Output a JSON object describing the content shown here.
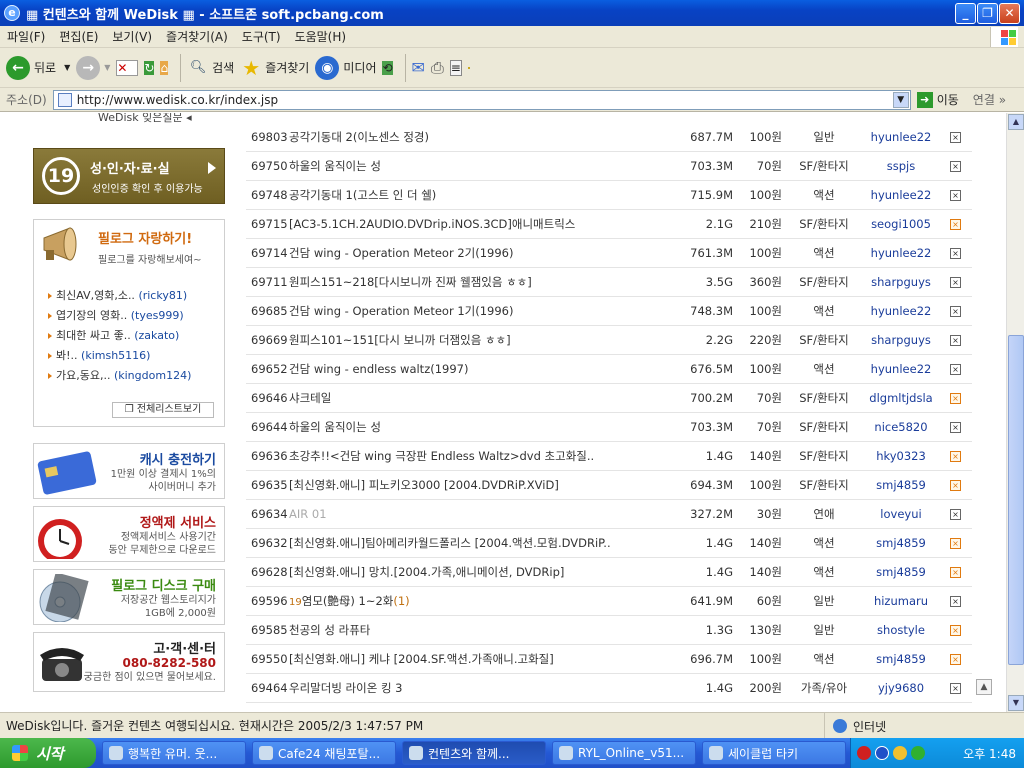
{
  "window": {
    "title": "▦ 컨텐츠와 함께 WeDisk ▦ - 소프트존 soft.pcbang.com",
    "min_label": "_",
    "max_label": "❐",
    "close_label": "✕"
  },
  "menu": [
    "파일(F)",
    "편집(E)",
    "보기(V)",
    "즐겨찾기(A)",
    "도구(T)",
    "도움말(H)"
  ],
  "toolbar": {
    "back": "뒤로",
    "search": "검색",
    "favorites": "즐겨찾기",
    "media": "미디어"
  },
  "address": {
    "label": "주소(D)",
    "url": "http://www.wedisk.co.kr/index.jsp",
    "go": "이동",
    "links": "연결"
  },
  "sidebar": {
    "top_note": "WeDisk 잊은질문",
    "adult": {
      "badge": "19",
      "title": "성·인·자·료·실",
      "subtitle": "성인인증 확인 후 이용가능"
    },
    "brag": {
      "title": "필로그 자랑하기!",
      "subtitle": "필로그를 자랑해보세여~",
      "items": [
        {
          "title": "최신AV,영화,소..",
          "user": "(ricky81)"
        },
        {
          "title": "엽기장의 영화..",
          "user": "(tyes999)"
        },
        {
          "title": "최대한 싸고 좋..",
          "user": "(zakato)"
        },
        {
          "title": "봐!..",
          "user": "(kimsh5116)"
        },
        {
          "title": "가요,동요,..",
          "user": "(kingdom124)"
        }
      ],
      "more": "전체리스트보기"
    },
    "promos": [
      {
        "title": "캐시 충전하기",
        "sub1": "1만원 이상 결제시 1%의",
        "sub2": "사이버머니 추가",
        "color": "#1a4aa0"
      },
      {
        "title": "정액제 서비스",
        "sub1": "정액제서비스 사용기간",
        "sub2": "동안 무제한으로 다운로드",
        "color": "#b01818"
      },
      {
        "title": "필로그 디스크 구매",
        "sub1": "저장공간 웹스토리지가",
        "sub2": "1GB에 2,000원",
        "color": "#3a8a10"
      },
      {
        "title": "고·객·센·터",
        "sub1": "080-8282-580",
        "sub2": "궁금한 점이 있으면 물어보세요.",
        "color": "#222"
      }
    ]
  },
  "list": [
    {
      "num": "69803",
      "title": "공각기동대 2(이노센스 정경)",
      "size": "687.7M",
      "price": "100원",
      "genre": "일반",
      "user": "hyunlee22",
      "box": "gray"
    },
    {
      "num": "69750",
      "title": "하울의 움직이는 성",
      "size": "703.3M",
      "price": "70원",
      "genre": "SF/환타지",
      "user": "sspjs",
      "box": "gray"
    },
    {
      "num": "69748",
      "title": "공각기동대 1(고스트 인 더 쉘)",
      "size": "715.9M",
      "price": "100원",
      "genre": "액션",
      "user": "hyunlee22",
      "box": "gray"
    },
    {
      "num": "69715",
      "title": "[AC3-5.1CH.2AUDIO.DVDrip.iNOS.3CD]애니매트릭스",
      "size": "2.1G",
      "price": "210원",
      "genre": "SF/환타지",
      "user": "seogi1005",
      "box": "orange"
    },
    {
      "num": "69714",
      "title": "건담 wing - Operation Meteor 2기(1996)",
      "size": "761.3M",
      "price": "100원",
      "genre": "액션",
      "user": "hyunlee22",
      "box": "gray"
    },
    {
      "num": "69711",
      "title": "원피스151~218[다시보니까 진짜 웰잼있음 ㅎㅎ]",
      "size": "3.5G",
      "price": "360원",
      "genre": "SF/환타지",
      "user": "sharpguys",
      "box": "gray"
    },
    {
      "num": "69685",
      "title": "건담 wing - Operation Meteor 1기(1996)",
      "size": "748.3M",
      "price": "100원",
      "genre": "액션",
      "user": "hyunlee22",
      "box": "gray"
    },
    {
      "num": "69669",
      "title": "원피스101~151[다시 보니까 더잼있음 ㅎㅎ]",
      "size": "2.2G",
      "price": "220원",
      "genre": "SF/환타지",
      "user": "sharpguys",
      "box": "gray"
    },
    {
      "num": "69652",
      "title": "건담 wing - endless waltz(1997)",
      "size": "676.5M",
      "price": "100원",
      "genre": "액션",
      "user": "hyunlee22",
      "box": "gray"
    },
    {
      "num": "69646",
      "title": "샤크테일",
      "size": "700.2M",
      "price": "70원",
      "genre": "SF/환타지",
      "user": "dlgmltjdsla",
      "box": "orange"
    },
    {
      "num": "69644",
      "title": "하울의 움직이는 성",
      "size": "703.3M",
      "price": "70원",
      "genre": "SF/환타지",
      "user": "nice5820",
      "box": "gray"
    },
    {
      "num": "69636",
      "title": "초강추!!<건담 wing 극장판 Endless Waltz>dvd 초고화질..",
      "size": "1.4G",
      "price": "140원",
      "genre": "SF/환타지",
      "user": "hky0323",
      "box": "orange"
    },
    {
      "num": "69635",
      "title": "[최신영화.애니] 피노키오3000 [2004.DVDRiP.XViD]",
      "size": "694.3M",
      "price": "100원",
      "genre": "SF/환타지",
      "user": "smj4859",
      "box": "orange"
    },
    {
      "num": "69634",
      "title": "AIR 01",
      "size": "327.2M",
      "price": "30원",
      "genre": "연애",
      "user": "loveyui",
      "box": "gray",
      "gray": true
    },
    {
      "num": "69632",
      "title": "[최신영화.애니]팀아메리카월드폴리스 [2004.액션.모험.DVDRiP..",
      "size": "1.4G",
      "price": "140원",
      "genre": "액션",
      "user": "smj4859",
      "box": "orange"
    },
    {
      "num": "69628",
      "title": "[최신영화.애니] 망치.[2004.가족,애니메이션, DVDRip]",
      "size": "1.4G",
      "price": "140원",
      "genre": "액션",
      "user": "smj4859",
      "box": "orange"
    },
    {
      "num": "69596",
      "title_pre": "19",
      "title": "염모(艶母) 1~2화",
      "title_cnt": "(1)",
      "size": "641.9M",
      "price": "60원",
      "genre": "일반",
      "user": "hizumaru",
      "box": "gray"
    },
    {
      "num": "69585",
      "title": "천공의 성 라퓨타",
      "size": "1.3G",
      "price": "130원",
      "genre": "일반",
      "user": "shostyle",
      "box": "orange"
    },
    {
      "num": "69550",
      "title": "[최신영화.애니] 케냐 [2004.SF.액션.가족애니.고화질]",
      "size": "696.7M",
      "price": "100원",
      "genre": "액션",
      "user": "smj4859",
      "box": "orange"
    },
    {
      "num": "69464",
      "title": "우리말더빙 라이온 킹 3",
      "size": "1.4G",
      "price": "200원",
      "genre": "가족/유아",
      "user": "yjy9680",
      "box": "gray"
    }
  ],
  "status": {
    "message": "WeDisk입니다. 즐거운 컨텐츠 여행되십시요. 현재시간은 2005/2/3 1:47:57 PM",
    "zone": "인터넷"
  },
  "taskbar": {
    "start": "시작",
    "tasks": [
      "행복한 유머. 웃...",
      "Cafe24 채팅포탈...",
      "컨텐츠와 함께...",
      "RYL_Online_v51...",
      "세이클럽 타키"
    ],
    "clock": "오후 1:48"
  }
}
